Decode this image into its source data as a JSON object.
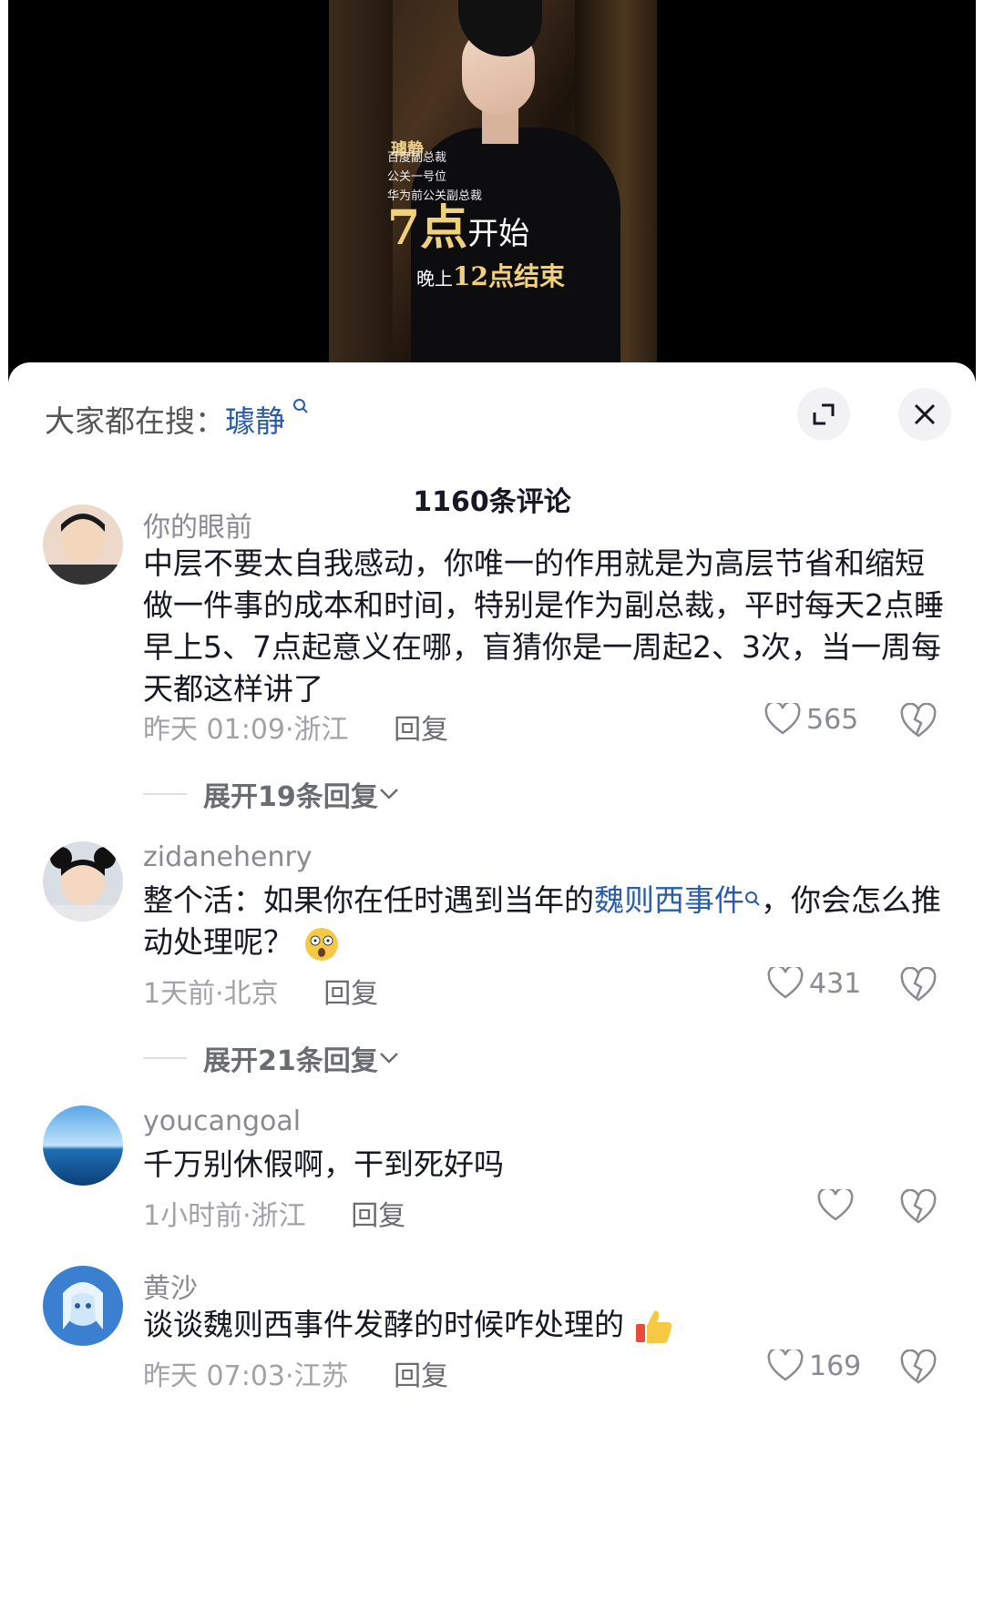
{
  "video": {
    "name": "璩静",
    "titles": [
      "百度副总裁",
      "公关一号位",
      "华为前公关副总裁"
    ],
    "big_text": "7点",
    "big_text_tail": "开始",
    "end_text_prefix": "晚上",
    "end_text": "12点结束"
  },
  "search": {
    "prefix": "大家都在搜：",
    "term": "璩静"
  },
  "comment_count": "1160条评论",
  "comments": [
    {
      "user": "你的眼前",
      "text": "中层不要太自我感动，你唯一的作用就是为高层节省和缩短做一件事的成本和时间，特别是作为副总裁，平时每天2点睡早上5、7点起意义在哪，盲猜你是一周起2、3次，当一周每天都这样讲了",
      "time": "昨天 01:09",
      "location": "浙江",
      "reply": "回复",
      "likes": "565",
      "expand": "展开19条回复"
    },
    {
      "user": "zidanehenry",
      "text_before": "整个活：如果你在任时遇到当年的",
      "text_link": "魏则西事件",
      "text_after": "，你会怎么推动处理呢？",
      "time": "1天前",
      "location": "北京",
      "reply": "回复",
      "likes": "431",
      "expand": "展开21条回复"
    },
    {
      "user": "youcangoal",
      "text": "千万别休假啊，干到死好吗",
      "time": "1小时前",
      "location": "浙江",
      "reply": "回复",
      "likes": ""
    },
    {
      "user": "黄沙",
      "text": "谈谈魏则西事件发酵的时候咋处理的",
      "time": "昨天 07:03",
      "location": "江苏",
      "reply": "回复",
      "likes": "169"
    }
  ],
  "icons": {
    "search": "search-icon",
    "expand": "expand-icon",
    "close": "close-icon",
    "heart": "heart-icon",
    "dislike": "broken-heart-icon",
    "chevron": "chevron-down-icon"
  },
  "colors": {
    "link": "#2a5caa",
    "meta": "#a1a2a7",
    "text": "#161823"
  }
}
